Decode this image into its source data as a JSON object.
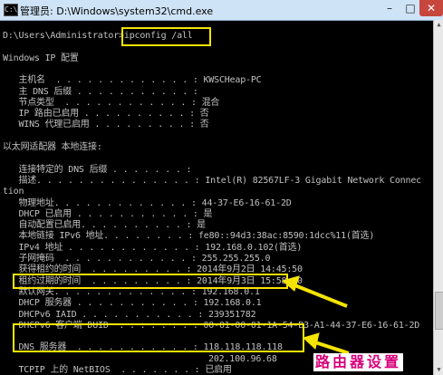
{
  "window": {
    "title": "管理员: D:\\Windows\\system32\\cmd.exe",
    "minimize_label": "–",
    "maximize_label": "□",
    "close_label": "✕",
    "icon": "console-app-icon"
  },
  "console": {
    "lines": [
      "D:\\Users\\Administrator>ipconfig /all",
      "",
      "Windows IP 配置",
      "",
      "   主机名  . . . . . . . . . . . . . : KWSCHeap-PC",
      "   主 DNS 后缀 . . . . . . . . . . . :",
      "   节点类型  . . . . . . . . . . . . : 混合",
      "   IP 路由已启用 . . . . . . . . . . : 否",
      "   WINS 代理已启用 . . . . . . . . . : 否",
      "",
      "以太网适配器 本地连接:",
      "",
      "   连接特定的 DNS 后缀 . . . . . . . :",
      "   描述. . . . . . . . . . . . . . . : Intel(R) 82567LF-3 Gigabit Network Connec",
      "tion",
      "   物理地址. . . . . . . . . . . . . : 44-37-E6-16-61-2D",
      "   DHCP 已启用 . . . . . . . . . . . : 是",
      "   自动配置已启用. . . . . . . . . . : 是",
      "   本地链接 IPv6 地址. . . . . . . . : fe80::94d3:38ac:8590:1dcc%11(首选)",
      "   IPv4 地址 . . . . . . . . . . . . : 192.168.0.102(首选)",
      "   子网掩码  . . . . . . . . . . . . : 255.255.255.0",
      "   获得租约的时间  . . . . . . . . . : 2014年9月2日 14:45:50",
      "   租约过期的时间  . . . . . . . . . : 2014年9月3日 15:58:10",
      "   默认网关. . . . . . . . . . . . . : 192.168.0.1",
      "   DHCP 服务器 . . . . . . . . . . . : 192.168.0.1",
      "   DHCPv6 IAID . . . . . . . . . . . : 239351782",
      "   DHCPv6 客户端 DUID  . . . . . . . : 00-01-00-01-1A-54-B3-A1-44-37-E6-16-61-2D",
      "",
      "   DNS 服务器  . . . . . . . . . . . : 118.118.118.118",
      "                                       202.100.96.68",
      "   TCPIP 上的 NetBIOS  . . . . . . . : 已启用"
    ]
  },
  "watermark": "路由器设置",
  "colors": {
    "console_bg": "#000000",
    "console_text": "#c0c0c0",
    "highlight": "#f5e400",
    "watermark": "#d7007a"
  }
}
